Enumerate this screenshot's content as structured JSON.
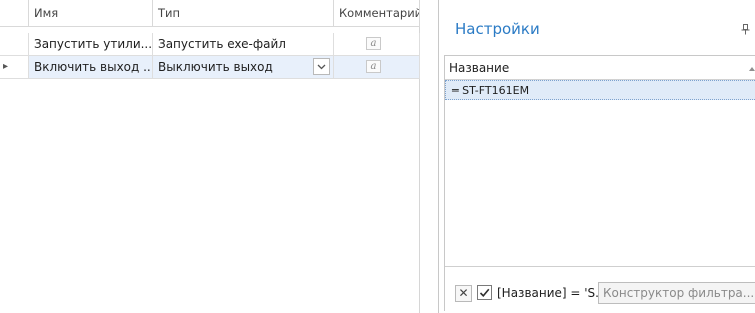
{
  "left_grid": {
    "columns": [
      "Имя",
      "Тип",
      "Комментарий"
    ],
    "rows": [
      {
        "name": "Запустить утили...",
        "type": "Запустить exe-файл",
        "comment_icon": "a"
      },
      {
        "name": "Включить выход ...",
        "type": "Выключить выход",
        "comment_icon": "a"
      }
    ],
    "current_row_indicator": "▸",
    "dropdown_arrow": "⌄"
  },
  "right_panel": {
    "title": "Настройки",
    "pin_icon": "⊥",
    "grid": {
      "column": "Название",
      "rows": [
        "═ ST-FT161EM"
      ]
    },
    "filter": {
      "clear_symbol": "✕",
      "check_symbol": "✓",
      "text": "[Название] = 'S...",
      "builder_label": "Конструктор фильтра..."
    }
  },
  "colors": {
    "accent": "#2b7bc5",
    "selected_row": "#e8f0fb",
    "list_selected": "#e0ebf8"
  }
}
